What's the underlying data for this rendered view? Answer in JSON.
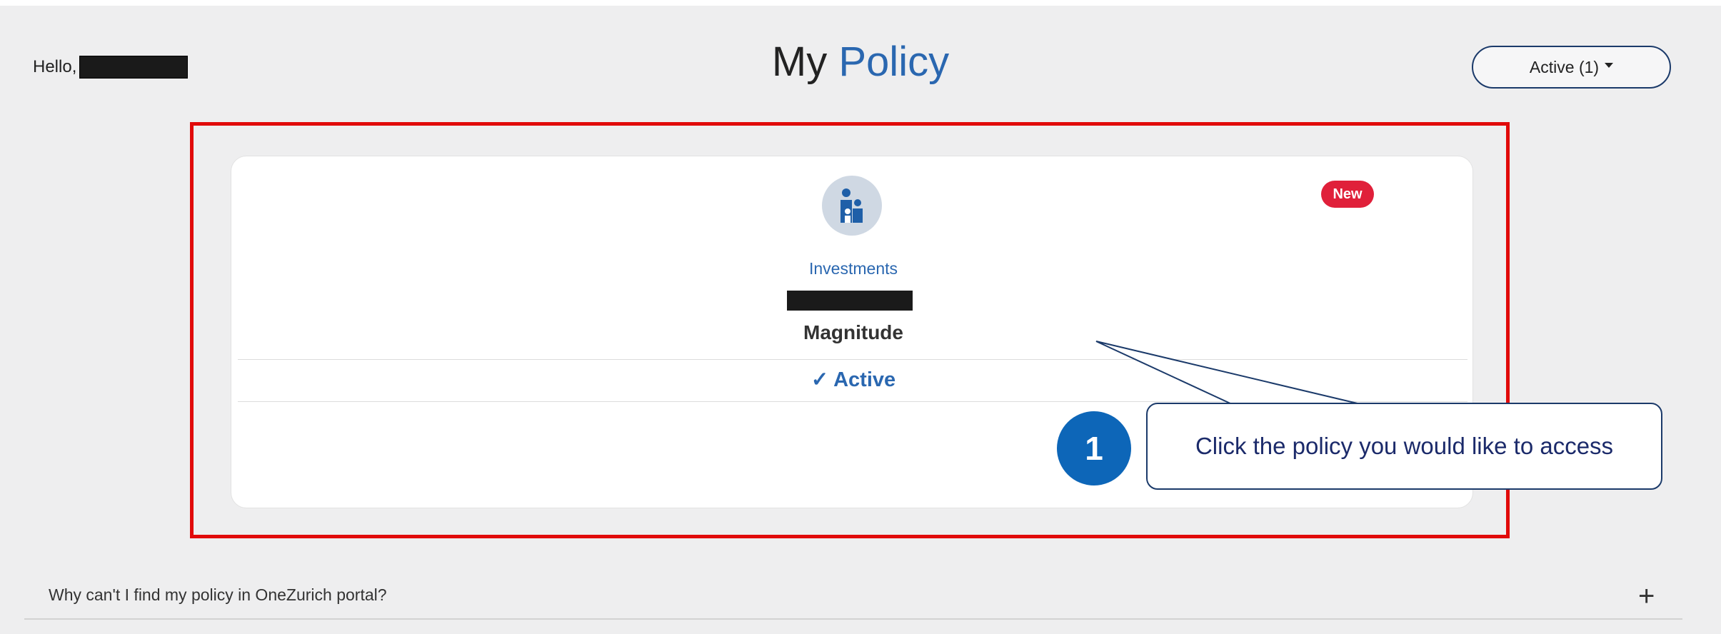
{
  "header": {
    "greeting": "Hello,",
    "title_part1": "My",
    "title_part2": "Policy",
    "filter_label": "Active (1)"
  },
  "policy_card": {
    "icon": "family-icon",
    "badge": "New",
    "category": "Investments",
    "product_name": "Magnitude",
    "status": "✓ Active"
  },
  "tutorial": {
    "step_number": "1",
    "callout_text": "Click the policy you would like to access"
  },
  "faq": {
    "question": "Why can't I find my policy in OneZurich portal?",
    "toggle": "+"
  },
  "colors": {
    "accent_blue": "#2a67b0",
    "highlight_red": "#e10a0a",
    "badge_red": "#e0203a",
    "step_blue": "#0d66b8"
  }
}
